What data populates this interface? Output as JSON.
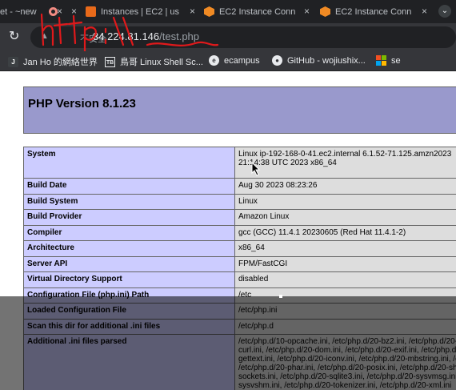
{
  "browser": {
    "tabs": [
      {
        "label": "et - ~new"
      },
      {
        "label": ""
      },
      {
        "label": "Instances | EC2 | us"
      },
      {
        "label": "EC2 Instance Conn"
      },
      {
        "label": "EC2 Instance Conn"
      }
    ],
    "close_glyph": "×",
    "address": {
      "secure_label": "不安全",
      "host": "34.224.81.146",
      "path": "/test.php",
      "handwritten": "http"
    },
    "bookmarks": [
      {
        "label": "Jan Ho 的網絡世界",
        "icon": "J"
      },
      {
        "label": "鳥哥 Linux Shell Sc...",
        "icon": "TB"
      },
      {
        "label": "ecampus",
        "icon": "e"
      },
      {
        "label": "GitHub - wojiushix...",
        "icon": "github-icon"
      },
      {
        "label": "se",
        "icon": "windows-icon"
      }
    ]
  },
  "phpinfo": {
    "title": "PHP Version 8.1.23",
    "rows": [
      {
        "key": "System",
        "lines": [
          "Linux ip-192-168-0-41.ec2.internal 6.1.52-71.125.amzn2023",
          "21:14:38 UTC 2023 x86_64"
        ]
      },
      {
        "key": "Build Date",
        "lines": [
          "Aug 30 2023 08:23:26"
        ]
      },
      {
        "key": "Build System",
        "lines": [
          "Linux"
        ]
      },
      {
        "key": "Build Provider",
        "lines": [
          "Amazon Linux"
        ]
      },
      {
        "key": "Compiler",
        "lines": [
          "gcc (GCC) 11.4.1 20230605 (Red Hat 11.4.1-2)"
        ]
      },
      {
        "key": "Architecture",
        "lines": [
          "x86_64"
        ]
      },
      {
        "key": "Server API",
        "lines": [
          "FPM/FastCGI"
        ]
      },
      {
        "key": "Virtual Directory Support",
        "lines": [
          "disabled"
        ]
      },
      {
        "key": "Configuration File (php.ini) Path",
        "lines": [
          "/etc"
        ]
      },
      {
        "key": "Loaded Configuration File",
        "lines": [
          "/etc/php.ini"
        ]
      },
      {
        "key": "Scan this dir for additional .ini files",
        "lines": [
          "/etc/php.d"
        ]
      },
      {
        "key": "Additional .ini files parsed",
        "lines": [
          "/etc/php.d/10-opcache.ini, /etc/php.d/20-bz2.ini, /etc/php.d/20-",
          "curl.ini, /etc/php.d/20-dom.ini, /etc/php.d/20-exif.ini, /etc/php.d/",
          "gettext.ini, /etc/php.d/20-iconv.ini, /etc/php.d/20-mbstring.ini, /e",
          "/etc/php.d/20-phar.ini, /etc/php.d/20-posix.ini, /etc/php.d/20-sh",
          "sockets.ini, /etc/php.d/20-sqlite3.ini, /etc/php.d/20-sysvmsg.ini",
          "sysvshm.ini, /etc/php.d/20-tokenizer.ini, /etc/php.d/20-xml.ini"
        ]
      }
    ]
  },
  "colors": {
    "php_header": "#9999cc",
    "key_cell": "#ccccff",
    "value_cell": "#dddddd",
    "chrome_dark": "#202124",
    "chrome_toolbar": "#35363a",
    "scribble_red": "#e0191b"
  }
}
